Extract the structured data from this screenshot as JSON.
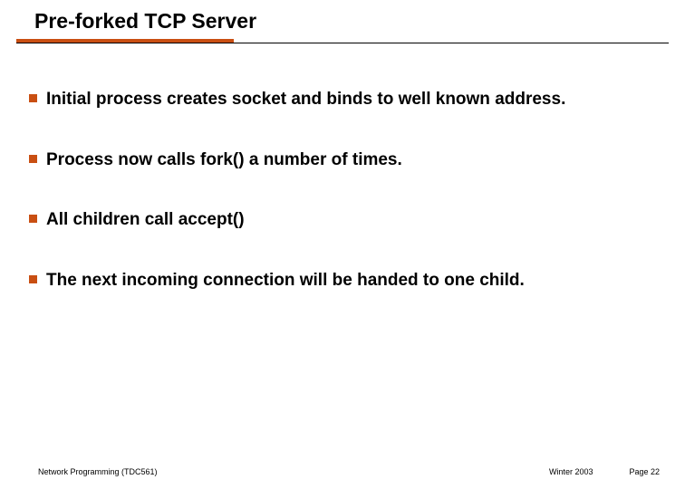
{
  "slide": {
    "title": "Pre-forked TCP Server",
    "bullets": [
      "Initial process creates socket and binds to well known address.",
      "Process now calls fork() a number of times.",
      "All children call accept()",
      "The next incoming connection will be handed to one child."
    ],
    "footer": {
      "left": "Network Programming (TDC561)",
      "term": "Winter 2003",
      "page": "Page 22"
    }
  }
}
